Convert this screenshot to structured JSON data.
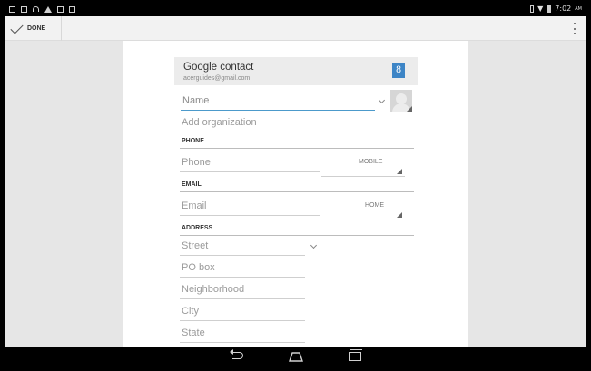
{
  "status_bar": {
    "time": "7:02",
    "ampm": "AM",
    "left_icons": [
      "gallery-icon",
      "barcode-icon",
      "wifi-icon",
      "alert-icon",
      "image-icon",
      "photo-icon"
    ]
  },
  "action_bar": {
    "done_label": "DONE"
  },
  "account": {
    "title": "Google contact",
    "email": "acerguides@gmail.com",
    "badge": "8"
  },
  "form": {
    "name_placeholder": "Name",
    "organization_placeholder": "Add organization",
    "phone_section": "PHONE",
    "phone_placeholder": "Phone",
    "phone_type": "MOBILE",
    "email_section": "EMAIL",
    "email_placeholder": "Email",
    "email_type": "HOME",
    "address_section": "ADDRESS",
    "street_placeholder": "Street",
    "pobox_placeholder": "PO box",
    "neighborhood_placeholder": "Neighborhood",
    "city_placeholder": "City",
    "state_placeholder": "State"
  },
  "colors": {
    "accent": "#4c9acb",
    "google_badge": "#3d85c6",
    "action_bar": "#f2f2f2",
    "background": "#e6e6e6"
  }
}
